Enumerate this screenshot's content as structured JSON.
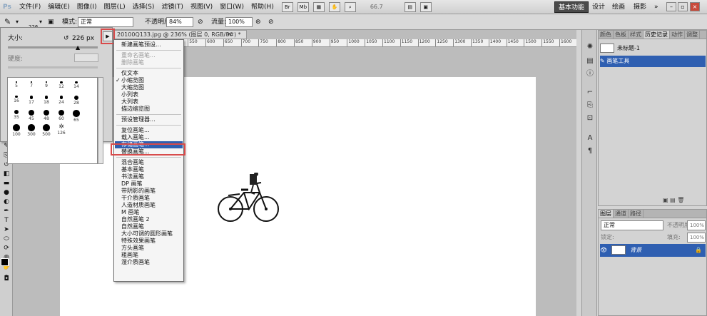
{
  "menubar": {
    "logo": "Ps",
    "items": [
      "文件(F)",
      "编辑(E)",
      "图像(I)",
      "图层(L)",
      "选择(S)",
      "滤镜(T)",
      "视图(V)",
      "窗口(W)",
      "帮助(H)"
    ],
    "zoom": "66.7",
    "workspaces": [
      "基本功能",
      "设计",
      "绘画",
      "摄影"
    ],
    "more": "»"
  },
  "options": {
    "brush_size": "226",
    "mode_label": "模式:",
    "mode_value": "正常",
    "opacity_label": "不透明度:",
    "opacity_value": "84%",
    "flow_label": "流量:",
    "flow_value": "100%"
  },
  "brush_panel": {
    "size_label": "大小:",
    "size_value": "226 px",
    "hardness_label": "硬度:",
    "grid": [
      {
        "label": "5",
        "r": 1
      },
      {
        "label": "7",
        "r": 1
      },
      {
        "label": "9",
        "r": 1
      },
      {
        "label": "12",
        "r": 2
      },
      {
        "label": "14",
        "r": 2
      },
      {
        "label": "16",
        "r": 2
      },
      {
        "label": "17",
        "r": 3
      },
      {
        "label": "18",
        "r": 3
      },
      {
        "label": "24",
        "r": 3
      },
      {
        "label": "28",
        "r": 4
      },
      {
        "label": "35",
        "r": 4
      },
      {
        "label": "45",
        "r": 5
      },
      {
        "label": "48",
        "r": 5
      },
      {
        "label": "60",
        "r": 5
      },
      {
        "label": "65",
        "r": 6
      },
      {
        "label": "100",
        "r": 6
      },
      {
        "label": "300",
        "r": 6
      },
      {
        "label": "500",
        "r": 6
      },
      {
        "label": "126",
        "r": 5
      }
    ]
  },
  "document": {
    "tab": "20100Q133.jpg @ 236% (图层 0, RGB/8#) *",
    "ruler_ticks": [
      "350",
      "400",
      "450",
      "500",
      "550",
      "600",
      "650",
      "700",
      "750",
      "800",
      "850",
      "900",
      "950",
      "1000",
      "1050",
      "1100",
      "1150",
      "1200",
      "1250",
      "1300",
      "1350",
      "1400",
      "1450",
      "1500",
      "1550",
      "1600",
      "1650",
      "1700",
      "1750"
    ]
  },
  "context_menu": {
    "items": [
      {
        "label": "新建画笔预设...",
        "state": "normal"
      },
      {
        "sep": true
      },
      {
        "label": "重命名画笔...",
        "state": "disabled"
      },
      {
        "label": "删除画笔",
        "state": "disabled"
      },
      {
        "sep": true
      },
      {
        "label": "仅文本",
        "state": "normal"
      },
      {
        "label": "小缩览图",
        "state": "checked"
      },
      {
        "label": "大缩览图",
        "state": "normal"
      },
      {
        "label": "小列表",
        "state": "normal"
      },
      {
        "label": "大列表",
        "state": "normal"
      },
      {
        "label": "描边缩览图",
        "state": "normal"
      },
      {
        "sep": true
      },
      {
        "label": "预设管理器...",
        "state": "normal"
      },
      {
        "sep": true
      },
      {
        "label": "复位画笔...",
        "state": "normal"
      },
      {
        "label": "载入画笔...",
        "state": "normal"
      },
      {
        "label": "存储画笔...",
        "state": "highlighted"
      },
      {
        "label": "替换画笔...",
        "state": "normal"
      },
      {
        "sep": true
      },
      {
        "label": "混合画笔",
        "state": "normal"
      },
      {
        "label": "基本画笔",
        "state": "normal"
      },
      {
        "label": "书法画笔",
        "state": "normal"
      },
      {
        "label": "DP 画笔",
        "state": "normal"
      },
      {
        "label": "带阴影的画笔",
        "state": "normal"
      },
      {
        "label": "干介质画笔",
        "state": "normal"
      },
      {
        "label": "人造材质画笔",
        "state": "normal"
      },
      {
        "label": "M 画笔",
        "state": "normal"
      },
      {
        "label": "自然画笔 2",
        "state": "normal"
      },
      {
        "label": "自然画笔",
        "state": "normal"
      },
      {
        "label": "大小可调的圆形画笔",
        "state": "normal"
      },
      {
        "label": "特殊效果画笔",
        "state": "normal"
      },
      {
        "label": "方头画笔",
        "state": "normal"
      },
      {
        "label": "粗画笔",
        "state": "normal"
      },
      {
        "label": "湿介质画笔",
        "state": "normal"
      }
    ]
  },
  "history_panel": {
    "tabs": [
      "颜色",
      "色板",
      "样式",
      "历史记录",
      "动作",
      "调整"
    ],
    "snapshot": "未标题-1",
    "rows": [
      "画笔工具"
    ]
  },
  "layers_panel": {
    "tabs": [
      "图层",
      "通道",
      "路径"
    ],
    "blend": "正常",
    "opacity_label": "不透明度:",
    "opacity_value": "100%",
    "lock_label": "锁定:",
    "fill_label": "填充:",
    "fill_value": "100%",
    "layer_name": "背景"
  },
  "colors": {
    "accent": "#2f5fb1",
    "highlight_box": "#d84b4b"
  }
}
